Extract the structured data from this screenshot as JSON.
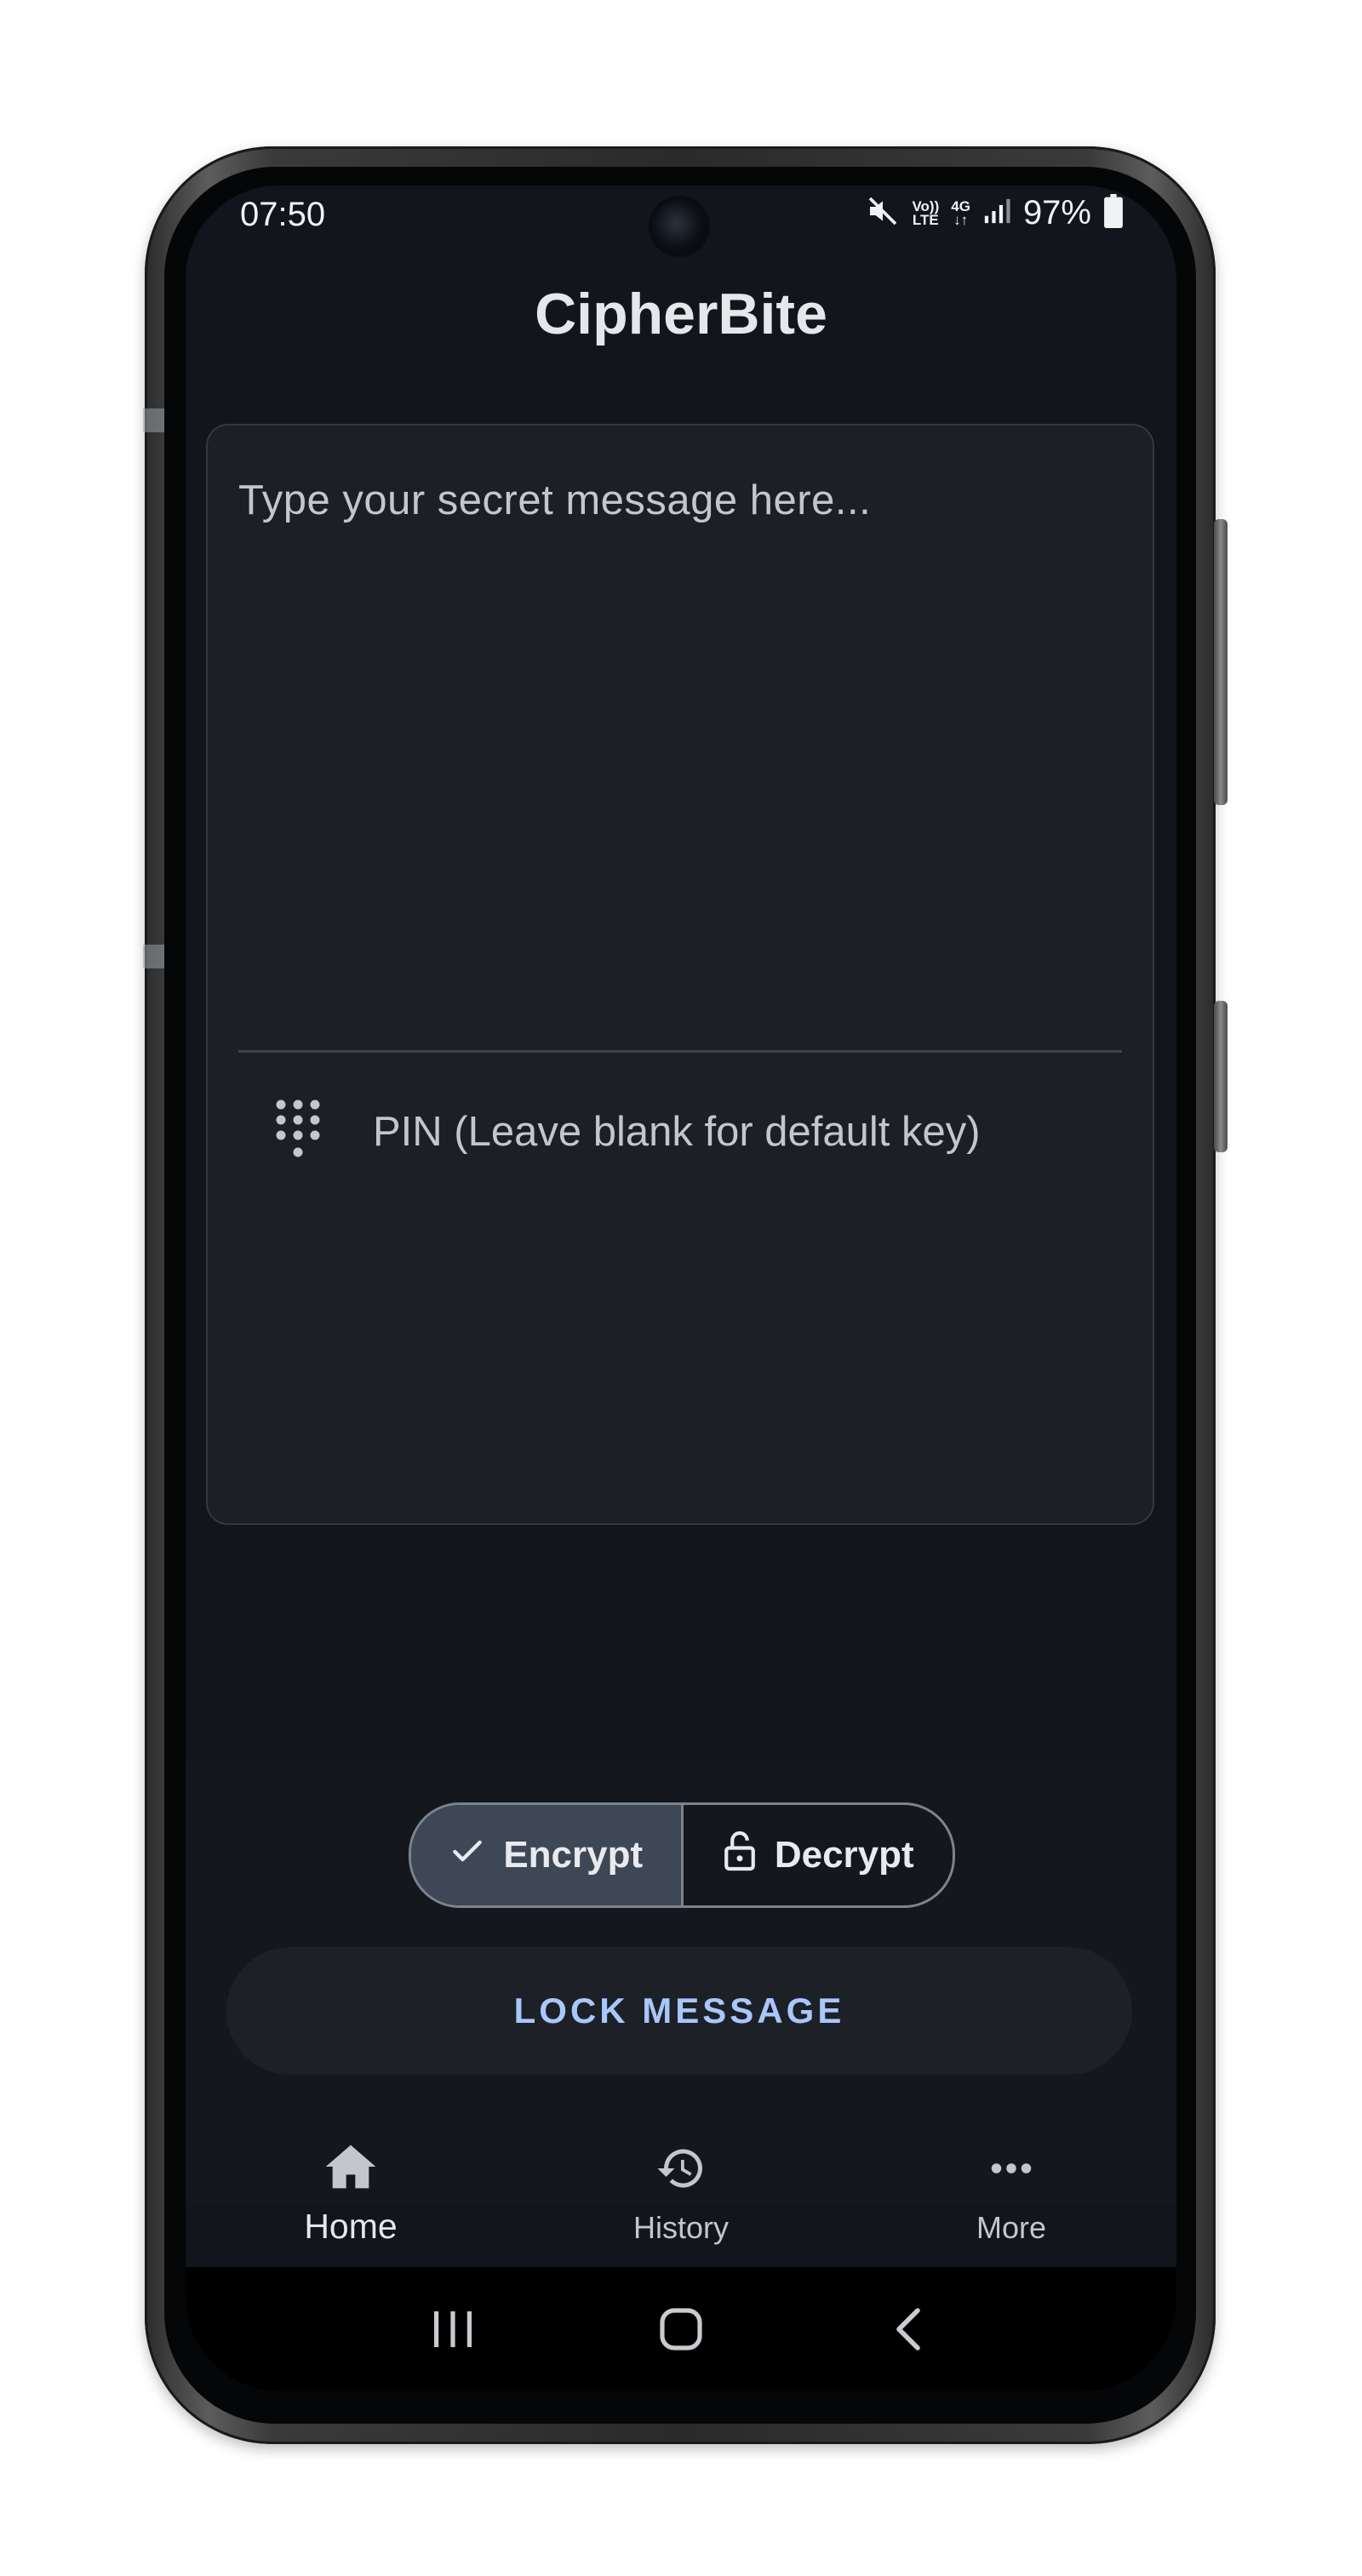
{
  "status_bar": {
    "time": "07:50",
    "volte": "Vo))\nLTE",
    "network": "4G",
    "battery": "97%",
    "icons": [
      "mute-icon",
      "volte-icon",
      "4g-data-icon",
      "signal-icon",
      "battery-icon"
    ]
  },
  "app": {
    "title": "CipherBite"
  },
  "message_card": {
    "message_placeholder": "Type your secret message here...",
    "pin_placeholder": "PIN (Leave blank for default key)",
    "pin_icon": "dialpad-icon"
  },
  "mode_toggle": {
    "encrypt_label": "Encrypt",
    "decrypt_label": "Decrypt",
    "selected": "Encrypt"
  },
  "action": {
    "lock_label": "LOCK MESSAGE"
  },
  "bottom_nav": {
    "items": [
      {
        "label": "Home",
        "icon": "home-icon",
        "active": true
      },
      {
        "label": "History",
        "icon": "history-icon",
        "active": false
      },
      {
        "label": "More",
        "icon": "more-icon",
        "active": false
      }
    ]
  },
  "system_nav": {
    "buttons": [
      "recents-icon",
      "home-outline-icon",
      "back-icon"
    ]
  },
  "colors": {
    "background": "#12151b",
    "card": "#1c1f25",
    "accent": "#a8c7fa",
    "selected_segment": "#3e4756"
  }
}
